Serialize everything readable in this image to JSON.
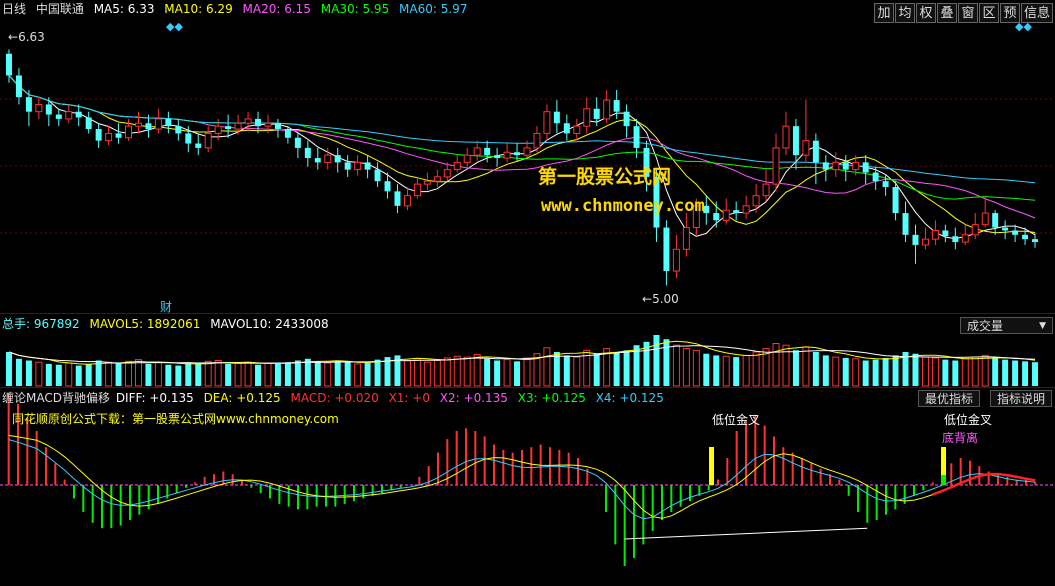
{
  "price_header": {
    "period": "日线",
    "stock_name": "中国联通",
    "ma5": "MA5: 6.33",
    "ma10": "MA10: 6.29",
    "ma20": "MA20: 6.15",
    "ma30": "MA30: 5.95",
    "ma60": "MA60: 5.97"
  },
  "toolbar": [
    "加",
    "均",
    "权",
    "叠",
    "窗",
    "区",
    "预",
    "信息"
  ],
  "price_panel": {
    "high_label": "6.63",
    "low_label": "5.00",
    "fin_marker": "财"
  },
  "watermark": {
    "title": "第一股票公式网",
    "url": "www.chnmoney.com"
  },
  "volume_header": {
    "total": "总手: 967892",
    "mavol5": "MAVOL5: 1892061",
    "mavol10": "MAVOL10: 2433008",
    "selector": "成交量"
  },
  "indicator_header": {
    "name": "缠论MACD背驰偏移",
    "diff": "DIFF: +0.135",
    "dea": "DEA: +0.125",
    "macd": "MACD: +0.020",
    "x1": "X1: +0",
    "x2": "X2: +0.135",
    "x3": "X3: +0.125",
    "x4": "X4: +0.125",
    "download_text": "同花顺原创公式下载：第一股票公式网www.chnmoney.com",
    "optimal_button": "最优指标",
    "explain_button": "指标说明",
    "signal_1": "低位金叉",
    "signal_2": "低位金叉",
    "signal_3": "底背离"
  },
  "colors": {
    "up": "#ff3333",
    "down": "#54ffff",
    "ma5": "#ffffff",
    "ma10": "#ffff00",
    "ma20": "#ff55ff",
    "ma30": "#00ff00",
    "ma60": "#33ccff",
    "grid": "#7a0000",
    "macd_up": "#ff3333",
    "macd_down": "#00ee00",
    "diff": "#ffffff",
    "dea": "#ffff00"
  },
  "chart_data": {
    "type": "candlestick",
    "price_range": [
      4.9,
      6.75
    ],
    "candles": [
      [
        6.6,
        6.45,
        6.63,
        6.4
      ],
      [
        6.45,
        6.3,
        6.5,
        6.25
      ],
      [
        6.3,
        6.2,
        6.35,
        6.1
      ],
      [
        6.2,
        6.25,
        6.3,
        6.15
      ],
      [
        6.25,
        6.18,
        6.3,
        6.1
      ],
      [
        6.18,
        6.15,
        6.22,
        6.1
      ],
      [
        6.15,
        6.2,
        6.25,
        6.12
      ],
      [
        6.2,
        6.16,
        6.25,
        6.1
      ],
      [
        6.16,
        6.08,
        6.2,
        6.05
      ],
      [
        6.08,
        6.0,
        6.12,
        5.95
      ],
      [
        6.0,
        6.05,
        6.1,
        5.97
      ],
      [
        6.05,
        6.02,
        6.12,
        5.98
      ],
      [
        6.02,
        6.1,
        6.15,
        6.0
      ],
      [
        6.1,
        6.12,
        6.2,
        6.05
      ],
      [
        6.12,
        6.08,
        6.18,
        6.02
      ],
      [
        6.08,
        6.15,
        6.22,
        6.05
      ],
      [
        6.15,
        6.1,
        6.2,
        6.05
      ],
      [
        6.1,
        6.05,
        6.15,
        6.0
      ],
      [
        6.05,
        5.98,
        6.1,
        5.92
      ],
      [
        5.98,
        5.95,
        6.05,
        5.9
      ],
      [
        5.95,
        6.05,
        6.1,
        5.92
      ],
      [
        6.05,
        6.1,
        6.15,
        6.0
      ],
      [
        6.1,
        6.08,
        6.18,
        6.02
      ],
      [
        6.08,
        6.12,
        6.18,
        6.04
      ],
      [
        6.12,
        6.15,
        6.2,
        6.08
      ],
      [
        6.15,
        6.1,
        6.2,
        6.05
      ],
      [
        6.1,
        6.12,
        6.18,
        6.05
      ],
      [
        6.12,
        6.08,
        6.15,
        6.02
      ],
      [
        6.08,
        6.02,
        6.1,
        5.98
      ],
      [
        6.02,
        5.95,
        6.05,
        5.88
      ],
      [
        5.95,
        5.88,
        6.0,
        5.82
      ],
      [
        5.88,
        5.85,
        5.95,
        5.8
      ],
      [
        5.85,
        5.9,
        5.95,
        5.8
      ],
      [
        5.9,
        5.85,
        5.95,
        5.78
      ],
      [
        5.85,
        5.8,
        5.9,
        5.75
      ],
      [
        5.8,
        5.85,
        5.9,
        5.76
      ],
      [
        5.85,
        5.8,
        5.9,
        5.74
      ],
      [
        5.8,
        5.72,
        5.85,
        5.68
      ],
      [
        5.72,
        5.65,
        5.78,
        5.6
      ],
      [
        5.65,
        5.55,
        5.7,
        5.5
      ],
      [
        5.55,
        5.62,
        5.68,
        5.52
      ],
      [
        5.62,
        5.7,
        5.75,
        5.6
      ],
      [
        5.7,
        5.72,
        5.78,
        5.66
      ],
      [
        5.72,
        5.75,
        5.8,
        5.68
      ],
      [
        5.75,
        5.8,
        5.85,
        5.72
      ],
      [
        5.8,
        5.85,
        5.9,
        5.78
      ],
      [
        5.85,
        5.9,
        5.95,
        5.82
      ],
      [
        5.9,
        5.95,
        6.0,
        5.86
      ],
      [
        5.95,
        5.9,
        6.0,
        5.85
      ],
      [
        5.9,
        5.88,
        5.95,
        5.82
      ],
      [
        5.88,
        5.92,
        5.98,
        5.85
      ],
      [
        5.92,
        5.9,
        5.98,
        5.86
      ],
      [
        5.9,
        5.95,
        6.0,
        5.88
      ],
      [
        5.95,
        6.05,
        6.1,
        5.92
      ],
      [
        6.05,
        6.2,
        6.25,
        6.0
      ],
      [
        6.2,
        6.12,
        6.28,
        6.05
      ],
      [
        6.12,
        6.05,
        6.18,
        6.0
      ],
      [
        6.05,
        6.1,
        6.15,
        6.0
      ],
      [
        6.1,
        6.22,
        6.3,
        6.05
      ],
      [
        6.22,
        6.15,
        6.3,
        6.1
      ],
      [
        6.15,
        6.28,
        6.35,
        6.12
      ],
      [
        6.28,
        6.2,
        6.35,
        6.15
      ],
      [
        6.2,
        6.1,
        6.25,
        6.02
      ],
      [
        6.1,
        5.95,
        6.15,
        5.88
      ],
      [
        5.95,
        5.75,
        6.0,
        5.65
      ],
      [
        5.75,
        5.4,
        5.8,
        5.3
      ],
      [
        5.4,
        5.1,
        5.45,
        5.0
      ],
      [
        5.1,
        5.25,
        5.35,
        5.05
      ],
      [
        5.25,
        5.4,
        5.5,
        5.2
      ],
      [
        5.4,
        5.55,
        5.6,
        5.35
      ],
      [
        5.55,
        5.5,
        5.62,
        5.42
      ],
      [
        5.5,
        5.45,
        5.58,
        5.4
      ],
      [
        5.45,
        5.52,
        5.6,
        5.42
      ],
      [
        5.52,
        5.5,
        5.58,
        5.45
      ],
      [
        5.5,
        5.55,
        5.62,
        5.46
      ],
      [
        5.55,
        5.62,
        5.7,
        5.5
      ],
      [
        5.62,
        5.7,
        5.8,
        5.58
      ],
      [
        5.7,
        5.95,
        6.05,
        5.65
      ],
      [
        5.95,
        6.1,
        6.2,
        5.9
      ],
      [
        6.1,
        5.9,
        6.15,
        5.8
      ],
      [
        5.9,
        6.0,
        6.28,
        5.85
      ],
      [
        6.0,
        5.85,
        6.05,
        5.7
      ],
      [
        5.85,
        5.8,
        5.9,
        5.72
      ],
      [
        5.8,
        5.85,
        5.92,
        5.75
      ],
      [
        5.85,
        5.8,
        5.9,
        5.72
      ],
      [
        5.8,
        5.85,
        5.9,
        5.76
      ],
      [
        5.85,
        5.78,
        5.9,
        5.7
      ],
      [
        5.78,
        5.72,
        5.82,
        5.66
      ],
      [
        5.72,
        5.68,
        5.76,
        5.62
      ],
      [
        5.68,
        5.5,
        5.72,
        5.45
      ],
      [
        5.5,
        5.35,
        5.58,
        5.3
      ],
      [
        5.35,
        5.28,
        5.42,
        5.15
      ],
      [
        5.28,
        5.32,
        5.4,
        5.25
      ],
      [
        5.32,
        5.38,
        5.45,
        5.28
      ],
      [
        5.38,
        5.34,
        5.42,
        5.3
      ],
      [
        5.34,
        5.3,
        5.4,
        5.25
      ],
      [
        5.3,
        5.35,
        5.42,
        5.28
      ],
      [
        5.35,
        5.42,
        5.5,
        5.32
      ],
      [
        5.42,
        5.5,
        5.62,
        5.4
      ],
      [
        5.5,
        5.4,
        5.52,
        5.35
      ],
      [
        5.4,
        5.38,
        5.45,
        5.32
      ],
      [
        5.38,
        5.35,
        5.42,
        5.3
      ],
      [
        5.35,
        5.32,
        5.4,
        5.28
      ],
      [
        5.32,
        5.3,
        5.36,
        5.26
      ]
    ],
    "volume": [
      40,
      32,
      30,
      28,
      26,
      25,
      27,
      24,
      26,
      30,
      28,
      27,
      29,
      31,
      26,
      28,
      25,
      24,
      27,
      26,
      29,
      30,
      26,
      27,
      28,
      25,
      27,
      26,
      28,
      30,
      32,
      29,
      27,
      30,
      28,
      26,
      27,
      31,
      34,
      36,
      30,
      32,
      28,
      30,
      33,
      35,
      34,
      37,
      32,
      30,
      31,
      29,
      33,
      38,
      45,
      40,
      36,
      34,
      42,
      38,
      44,
      40,
      42,
      48,
      52,
      60,
      55,
      48,
      44,
      42,
      38,
      36,
      35,
      34,
      36,
      40,
      44,
      50,
      48,
      42,
      46,
      40,
      36,
      34,
      33,
      32,
      30,
      31,
      33,
      36,
      40,
      38,
      34,
      33,
      31,
      30,
      32,
      34,
      36,
      33,
      31,
      30,
      29,
      28
    ],
    "macd": [
      0.34,
      0.3,
      0.25,
      0.2,
      0.14,
      0.08,
      0.02,
      -0.05,
      -0.1,
      -0.14,
      -0.16,
      -0.16,
      -0.15,
      -0.13,
      -0.11,
      -0.09,
      -0.07,
      -0.05,
      -0.03,
      -0.01,
      0.01,
      0.03,
      0.04,
      0.05,
      0.04,
      0.02,
      -0.01,
      -0.03,
      -0.05,
      -0.07,
      -0.08,
      -0.09,
      -0.09,
      -0.08,
      -0.08,
      -0.08,
      -0.07,
      -0.06,
      -0.05,
      -0.04,
      -0.03,
      -0.02,
      -0.01,
      0.0,
      0.03,
      0.07,
      0.12,
      0.17,
      0.2,
      0.21,
      0.2,
      0.18,
      0.15,
      0.13,
      0.12,
      0.13,
      0.14,
      0.15,
      0.14,
      0.13,
      0.12,
      0.1,
      0.06,
      0.0,
      -0.1,
      -0.22,
      -0.3,
      -0.27,
      -0.22,
      -0.17,
      -0.13,
      -0.1,
      -0.08,
      -0.06,
      -0.04,
      -0.02,
      0.02,
      0.1,
      0.2,
      0.24,
      0.26,
      0.22,
      0.18,
      0.14,
      0.12,
      0.1,
      0.08,
      0.06,
      0.04,
      0.02,
      -0.04,
      -0.1,
      -0.14,
      -0.13,
      -0.11,
      -0.09,
      -0.07,
      -0.04,
      -0.02,
      0.01,
      0.04,
      0.08,
      0.1,
      0.09,
      0.07,
      0.05,
      0.04,
      0.03,
      0.02,
      0.02,
      0.01
    ]
  }
}
